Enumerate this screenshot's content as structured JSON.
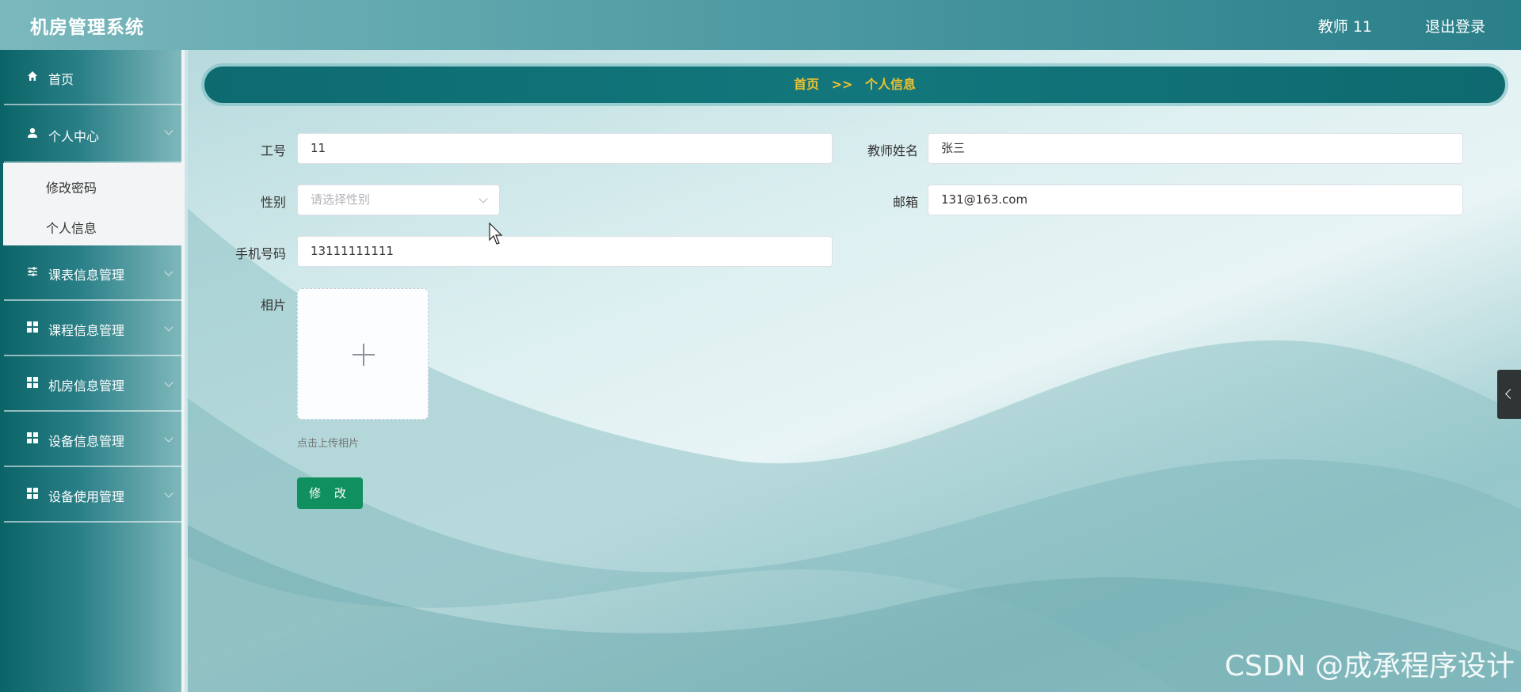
{
  "app": {
    "title": "机房管理系统"
  },
  "header": {
    "user_label": "教师 11",
    "logout_label": "退出登录"
  },
  "sidebar": {
    "items": [
      {
        "label": "首页",
        "icon": "home-icon"
      },
      {
        "label": "个人中心",
        "icon": "user-icon",
        "expanded": true,
        "children": [
          {
            "label": "修改密码"
          },
          {
            "label": "个人信息",
            "active": true
          }
        ]
      },
      {
        "label": "课表信息管理",
        "icon": "sliders-icon"
      },
      {
        "label": "课程信息管理",
        "icon": "grid-icon"
      },
      {
        "label": "机房信息管理",
        "icon": "grid-icon"
      },
      {
        "label": "设备信息管理",
        "icon": "grid-icon"
      },
      {
        "label": "设备使用管理",
        "icon": "grid-icon"
      }
    ]
  },
  "breadcrumb": {
    "home": "首页",
    "separator": ">>",
    "current": "个人信息"
  },
  "form": {
    "job_no": {
      "label": "工号",
      "value": "11"
    },
    "teacher_name": {
      "label": "教师姓名",
      "value": "张三"
    },
    "gender": {
      "label": "性别",
      "placeholder": "请选择性别"
    },
    "email": {
      "label": "邮箱",
      "value": "131@163.com"
    },
    "phone": {
      "label": "手机号码",
      "value": "13111111111"
    },
    "photo": {
      "label": "相片",
      "hint": "点击上传相片"
    },
    "submit_label": "修 改"
  },
  "watermark": "CSDN @成承程序设计",
  "colors": {
    "accent": "#11905f",
    "breadcrumb_text": "#f0c22e",
    "header": "#2a7f89"
  }
}
